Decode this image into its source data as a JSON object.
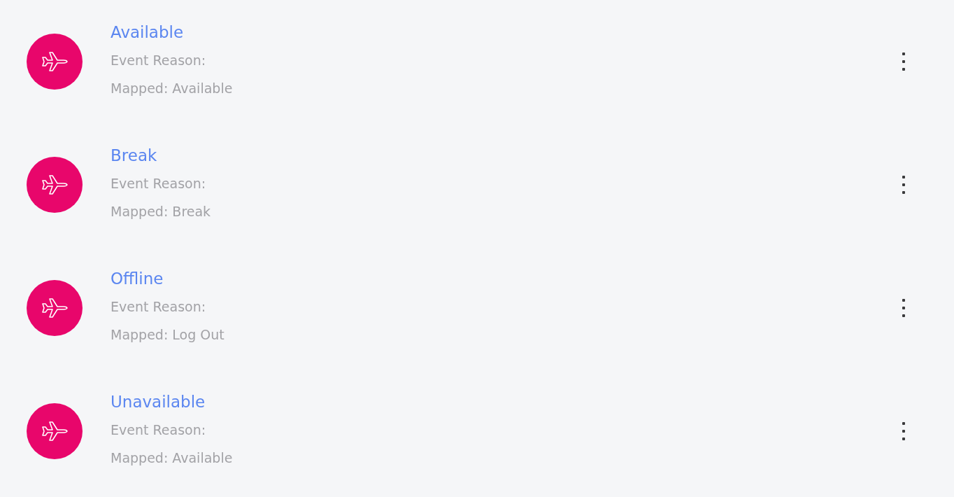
{
  "events": [
    {
      "title": "Available",
      "reason": "Event Reason:",
      "mapped": "Mapped: Available"
    },
    {
      "title": "Break",
      "reason": "Event Reason:",
      "mapped": "Mapped: Break"
    },
    {
      "title": "Offline",
      "reason": "Event Reason:",
      "mapped": "Mapped: Log Out"
    },
    {
      "title": "Unavailable",
      "reason": "Event Reason:",
      "mapped": "Mapped: Available"
    }
  ]
}
